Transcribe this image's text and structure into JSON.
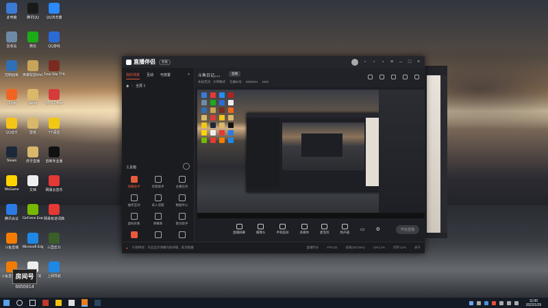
{
  "desktop": {
    "icons": [
      {
        "label": "此电脑",
        "color": "#3a7bd5"
      },
      {
        "label": "腾讯QQ",
        "color": "#1a1a1a"
      },
      {
        "label": "QQ浏览器",
        "color": "#2b8af7"
      },
      {
        "label": "永劫无间",
        "color": "#b22222"
      },
      {
        "label": "回收站",
        "color": "#6f8aa8"
      },
      {
        "label": "微信",
        "color": "#1aad19"
      },
      {
        "label": "QQ游戏",
        "color": "#2a6bd6"
      },
      {
        "label": "账号密码",
        "color": "#f2f2f2"
      },
      {
        "label": "控制面板",
        "color": "#2f6fb5"
      },
      {
        "label": "英雄联盟WeGame版",
        "color": "#c8a45a"
      },
      {
        "label": "Total War THREE KI...",
        "color": "#7a2a1f"
      },
      {
        "label": "Origin",
        "color": "#f26422"
      },
      {
        "label": "game",
        "color": "#d9b86b"
      },
      {
        "label": "WPS Office",
        "color": "#d63b3b"
      },
      {
        "label": "QQ音乐",
        "color": "#f5c518"
      },
      {
        "label": "壁纸",
        "color": "#d9b86b"
      },
      {
        "label": "YY语音",
        "color": "#f3c813"
      },
      {
        "label": "Steam",
        "color": "#1b2838"
      },
      {
        "label": "虎牙直播",
        "color": "#d9b86b"
      },
      {
        "label": "剪映专业版",
        "color": "#111111"
      },
      {
        "label": "WeGame",
        "color": "#ffd400"
      },
      {
        "label": "文档",
        "color": "#eeeeee"
      },
      {
        "label": "网易云音乐",
        "color": "#e53935"
      },
      {
        "label": "腾讯会议",
        "color": "#2c7be5"
      },
      {
        "label": "GeForce Experience",
        "color": "#76b900"
      },
      {
        "label": "网易有道词典",
        "color": "#e53935"
      },
      {
        "label": "斗鱼直播",
        "color": "#f57c00"
      },
      {
        "label": "Microsoft Edge",
        "color": "#1e88e5"
      },
      {
        "label": "三国志11",
        "color": "#3b5d2a"
      },
      {
        "label": "斗鱼直播伴侣",
        "color": "#f57c00"
      },
      {
        "label": "新建文件夹",
        "color": "#eeeeee"
      },
      {
        "label": "上网导航",
        "color": "#1e88e5"
      }
    ],
    "brand": {
      "logo_text": "房间号",
      "room_number": "6655914"
    }
  },
  "app": {
    "title": "直播伴侣",
    "version_badge": "新版",
    "sidebar_tabs": [
      "我的场景",
      "互动",
      "可放置"
    ],
    "scene_label": "全屏 1",
    "tools_title": "工具箱",
    "tools": [
      {
        "label": "弹幕助手",
        "highlight": true
      },
      {
        "label": "房管助手",
        "highlight": false
      },
      {
        "label": "主播任务",
        "highlight": false
      },
      {
        "label": "抽奖互动",
        "highlight": false
      },
      {
        "label": "录入话题",
        "highlight": false
      },
      {
        "label": "数据中心",
        "highlight": false
      },
      {
        "label": "虚拟形象",
        "highlight": false
      },
      {
        "label": "弹幕姬",
        "highlight": false
      },
      {
        "label": "歌词助手",
        "highlight": false
      },
      {
        "label": "",
        "highlight": true
      },
      {
        "label": "",
        "highlight": false
      },
      {
        "label": "",
        "highlight": false
      }
    ],
    "stream_title": "斗鱼日记。。。",
    "stream_title_btn": "直播",
    "stream_meta": [
      "永劫无间 · 大神模式",
      "包厢ID号",
      "6655914",
      "2602"
    ],
    "bottom_tools": [
      "直播屏幕",
      "摄像头",
      "手机投屏",
      "多媒体",
      "麦克风",
      "扬声器"
    ],
    "go_live": "开始直播",
    "status_warning": "礼物特效：点击显示弹幕列表待播，取消隐藏",
    "status_stats": [
      "直播时长",
      "FPS:30",
      "丢帧(0/0.00%)",
      "CPU:4%",
      "内存:11%",
      "关于"
    ]
  },
  "taskbar": {
    "time": "11:00",
    "date": "2022/1/29"
  }
}
